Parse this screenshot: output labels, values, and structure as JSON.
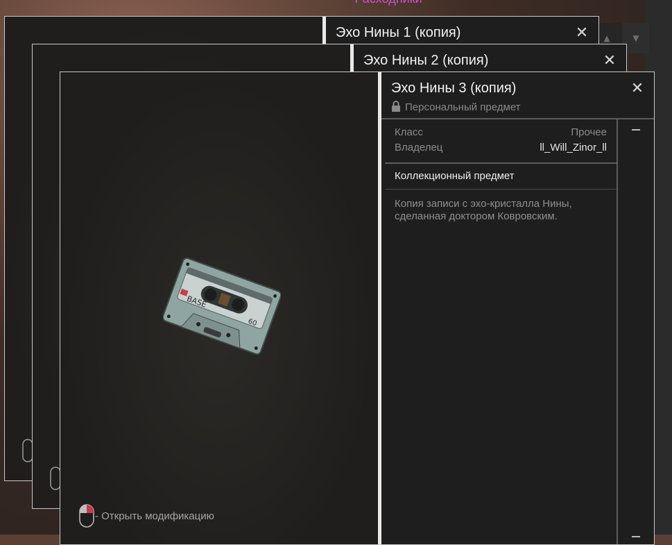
{
  "background": {
    "header_title": "Расходники"
  },
  "windows": [
    {
      "title": "Эхо Нины 1 (копия)"
    },
    {
      "title": "Эхо Нины 2 (копия)"
    },
    {
      "title": "Эхо Нины 3 (копия)",
      "subtitle": "Персональный предмет",
      "properties": [
        {
          "key": "Класс",
          "value": "Прочее"
        },
        {
          "key": "Владелец",
          "value": "ll_Will_Zinor_ll"
        }
      ],
      "section_title": "Коллекционный предмет",
      "description": "Копия записи с эхо-кристалла Нины, сделанная доктором Ковровским.",
      "hint": "- Открыть модификацию",
      "cassette": {
        "brand": "BASE",
        "length": "60"
      }
    }
  ],
  "icons": {
    "close": "close-icon",
    "lock": "lock-icon",
    "mouse": "mouse-left-click-icon"
  },
  "colors": {
    "accent_header": "#d24fd0",
    "panel_bg": "#1e1e1e",
    "title_bar_edge": "#e9e9e9",
    "mouse_button_red": "#c83b4b"
  }
}
